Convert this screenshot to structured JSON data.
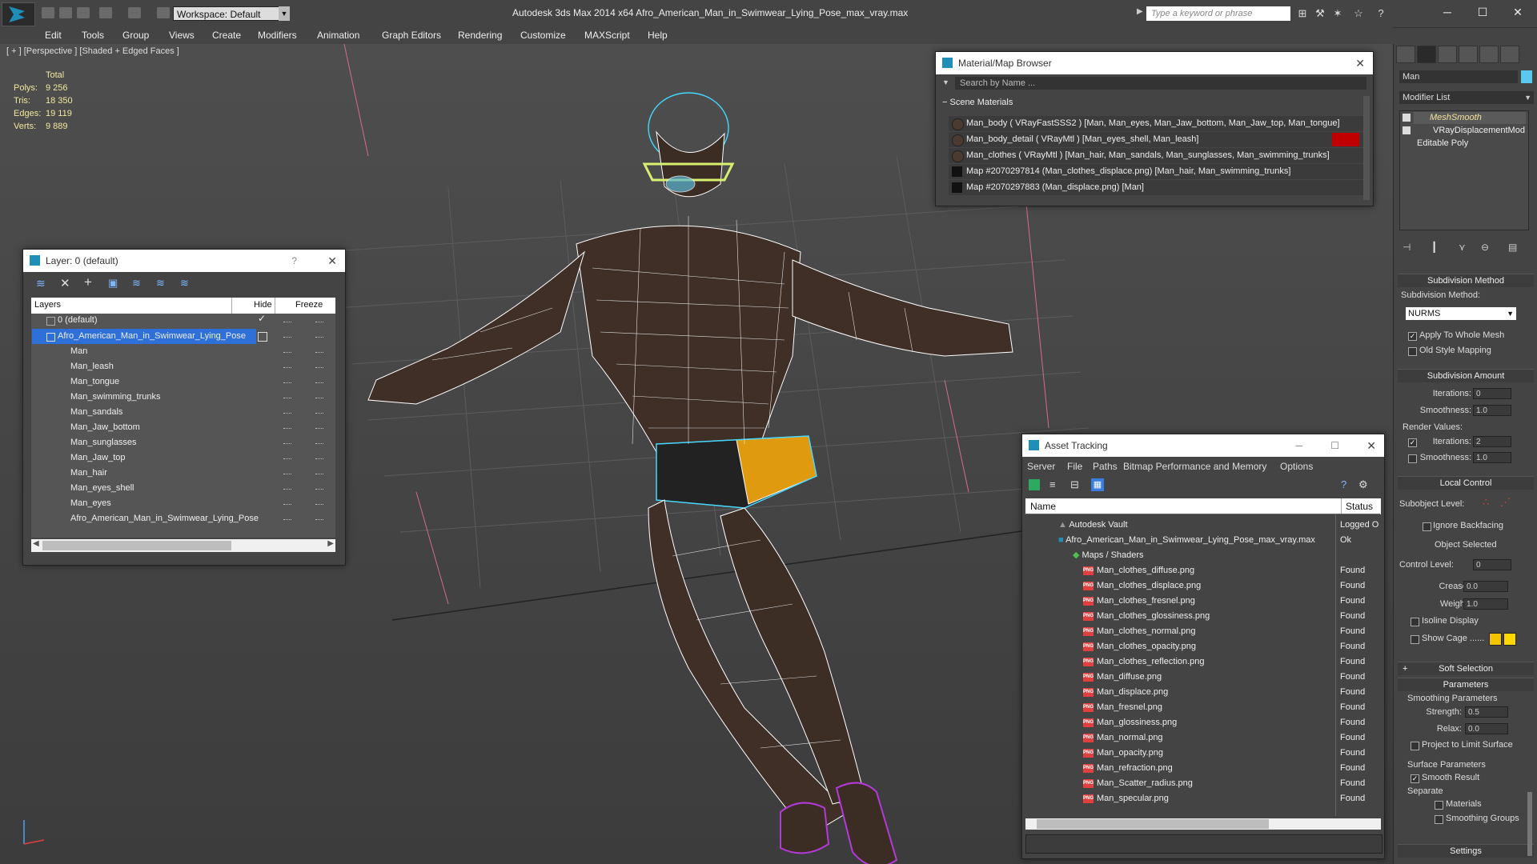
{
  "app": {
    "title": "Autodesk 3ds Max  2014 x64     Afro_American_Man_in_Swimwear_Lying_Pose_max_vray.max",
    "workspace": "Workspace: Default",
    "search_placeholder": "Type a keyword or phrase"
  },
  "menu": [
    "Edit",
    "Tools",
    "Group",
    "Views",
    "Create",
    "Modifiers",
    "Animation",
    "Graph Editors",
    "Rendering",
    "Customize",
    "MAXScript",
    "Help"
  ],
  "viewport": {
    "label": "[ + ] [Perspective ] [Shaded + Edged Faces ]",
    "stats": {
      "header": "Total",
      "rows": [
        {
          "label": "Polys:",
          "value": "9 256"
        },
        {
          "label": "Tris:",
          "value": "18 350"
        },
        {
          "label": "Edges:",
          "value": "19 119"
        },
        {
          "label": "Verts:",
          "value": "9 889"
        }
      ]
    }
  },
  "layer_window": {
    "title": "Layer: 0 (default)",
    "help": "?",
    "columns": {
      "layers": "Layers",
      "hide": "Hide",
      "freeze": "Freeze"
    },
    "rows": [
      {
        "name": "0 (default)",
        "level": 0
      },
      {
        "name": "Afro_American_Man_in_Swimwear_Lying_Pose",
        "level": 0,
        "selected": true
      },
      {
        "name": "Man",
        "level": 1
      },
      {
        "name": "Man_leash",
        "level": 1
      },
      {
        "name": "Man_tongue",
        "level": 1
      },
      {
        "name": "Man_swimming_trunks",
        "level": 1
      },
      {
        "name": "Man_sandals",
        "level": 1
      },
      {
        "name": "Man_Jaw_bottom",
        "level": 1
      },
      {
        "name": "Man_sunglasses",
        "level": 1
      },
      {
        "name": "Man_Jaw_top",
        "level": 1
      },
      {
        "name": "Man_hair",
        "level": 1
      },
      {
        "name": "Man_eyes_shell",
        "level": 1
      },
      {
        "name": "Man_eyes",
        "level": 1
      },
      {
        "name": "Afro_American_Man_in_Swimwear_Lying_Pose",
        "level": 1
      }
    ]
  },
  "material_browser": {
    "title": "Material/Map Browser",
    "search": "Search by Name ...",
    "section": "Scene Materials",
    "rows": [
      "Man_body  ( VRayFastSSS2 )  [Man, Man_eyes, Man_Jaw_bottom, Man_Jaw_top, Man_tongue]",
      "Man_body_detail  ( VRayMtl )  [Man_eyes_shell, Man_leash]",
      "Man_clothes  ( VRayMtl )  [Man_hair, Man_sandals, Man_sunglasses, Man_swimming_trunks]",
      "Map #2070297814 (Man_clothes_displace.png)  [Man_hair, Man_swimming_trunks]",
      "Map #2070297883 (Man_displace.png)  [Man]"
    ]
  },
  "asset_tracking": {
    "title": "Asset Tracking",
    "menu": [
      "Server",
      "File",
      "Paths",
      "Bitmap Performance and Memory",
      "Options"
    ],
    "columns": {
      "name": "Name",
      "status": "Status"
    },
    "vault": {
      "name": "Autodesk Vault",
      "status": "Logged O"
    },
    "scene": {
      "name": "Afro_American_Man_in_Swimwear_Lying_Pose_max_vray.max",
      "status": "Ok"
    },
    "group": "Maps / Shaders",
    "png_label": "PNG",
    "files": [
      {
        "name": "Man_clothes_diffuse.png",
        "status": "Found"
      },
      {
        "name": "Man_clothes_displace.png",
        "status": "Found"
      },
      {
        "name": "Man_clothes_fresnel.png",
        "status": "Found"
      },
      {
        "name": "Man_clothes_glossiness.png",
        "status": "Found"
      },
      {
        "name": "Man_clothes_normal.png",
        "status": "Found"
      },
      {
        "name": "Man_clothes_opacity.png",
        "status": "Found"
      },
      {
        "name": "Man_clothes_reflection.png",
        "status": "Found"
      },
      {
        "name": "Man_diffuse.png",
        "status": "Found"
      },
      {
        "name": "Man_displace.png",
        "status": "Found"
      },
      {
        "name": "Man_fresnel.png",
        "status": "Found"
      },
      {
        "name": "Man_glossiness.png",
        "status": "Found"
      },
      {
        "name": "Man_normal.png",
        "status": "Found"
      },
      {
        "name": "Man_opacity.png",
        "status": "Found"
      },
      {
        "name": "Man_refraction.png",
        "status": "Found"
      },
      {
        "name": "Man_Scatter_radius.png",
        "status": "Found"
      },
      {
        "name": "Man_specular.png",
        "status": "Found"
      }
    ]
  },
  "command_panel": {
    "object_name": "Man",
    "modifier_list": "Modifier List",
    "stack": [
      "MeshSmooth",
      "VRayDisplacementMod",
      "Editable Poly"
    ],
    "subdivision_method": {
      "header": "Subdivision Method",
      "label": "Subdivision Method:",
      "value": "NURMS",
      "apply_whole_mesh": "Apply To Whole Mesh",
      "old_style": "Old Style Mapping"
    },
    "subdivision_amount": {
      "header": "Subdivision Amount",
      "iterations_label": "Iterations:",
      "iterations": "0",
      "smoothness_label": "Smoothness:",
      "smoothness": "1.0",
      "render_values": "Render Values:",
      "r_iterations": "2",
      "r_smoothness": "1.0"
    },
    "local_control": {
      "header": "Local Control",
      "subobject": "Subobject Level:",
      "ignore_backfacing": "Ignore Backfacing",
      "object_selected": "Object Selected",
      "control_level_label": "Control Level:",
      "control_level": "0",
      "crease_label": "Crease:",
      "crease": "0.0",
      "weight_label": "Weight:",
      "weight": "1.0",
      "isoline": "Isoline Display",
      "show_cage": "Show Cage ......"
    },
    "soft_selection": {
      "sign": "+",
      "header": "Soft Selection"
    },
    "parameters": {
      "header": "Parameters",
      "smoothing_params": "Smoothing Parameters",
      "strength_label": "Strength:",
      "strength": "0.5",
      "relax_label": "Relax:",
      "relax": "0.0",
      "project_limit": "Project to Limit Surface",
      "surface_params": "Surface Parameters",
      "smooth_result": "Smooth Result",
      "separate": "Separate",
      "materials": "Materials",
      "smoothing_groups": "Smoothing Groups"
    },
    "settings": {
      "header": "Settings"
    }
  },
  "colors": {
    "accent": "#1f8fb8",
    "selection": "#2f6fd8",
    "skin": "#4b3a30",
    "trunks_orange": "#e09a10",
    "cage_yellow": "#f2c400",
    "hair_cyan": "#44d7ff",
    "shoes_purple": "#b43ad8"
  }
}
